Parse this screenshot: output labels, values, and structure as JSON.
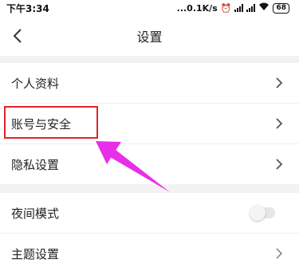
{
  "status_bar": {
    "time": "下午3:34",
    "network_speed": "...0.1K/s",
    "alarm_icon": "alarm-icon",
    "battery": "68"
  },
  "nav": {
    "title": "设置",
    "back_icon": "chevron-left-icon"
  },
  "settings": {
    "items": [
      {
        "label": "个人资料",
        "control": "chevron"
      },
      {
        "label": "账号与安全",
        "control": "chevron",
        "highlighted": true
      },
      {
        "label": "隐私设置",
        "control": "chevron"
      },
      {
        "label": "夜间模式",
        "control": "toggle",
        "on": false
      },
      {
        "label": "主题设置",
        "control": "chevron"
      }
    ]
  },
  "colors": {
    "highlight": "#e0242b",
    "arrow": "#e82ee8",
    "section_gap": "#f2f2f2"
  }
}
